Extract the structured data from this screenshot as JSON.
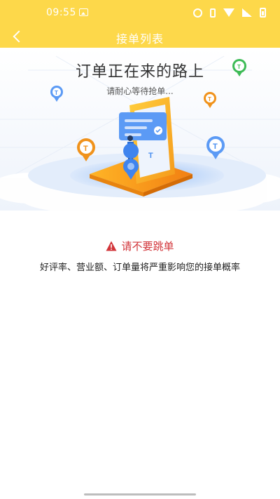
{
  "status_bar": {
    "time": "09:55"
  },
  "header": {
    "title": "接单列表"
  },
  "waiting": {
    "title": "订单正在来的路上",
    "subtitle": "请耐心等待抢单..."
  },
  "warning": {
    "title": "请不要跳单",
    "message": "好评率、营业额、订单量将严重影响您的接单概率"
  },
  "colors": {
    "header_bg": "#fdd84a",
    "warning_red": "#d2353a",
    "accent_blue": "#4a8ff0",
    "accent_orange": "#f5a623"
  }
}
